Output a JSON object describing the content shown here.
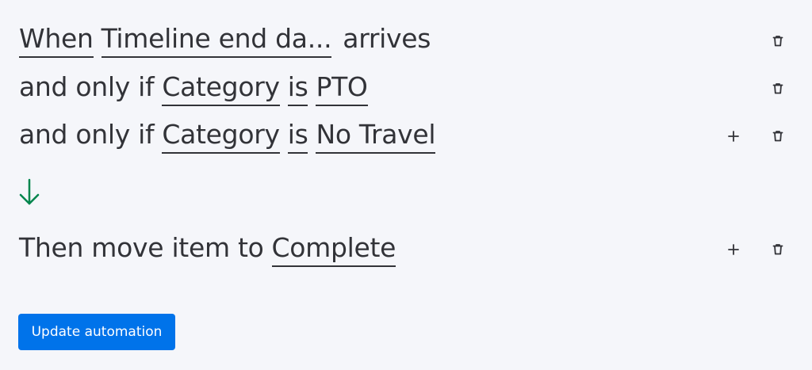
{
  "colors": {
    "background": "#f5f6fa",
    "text": "#323338",
    "accent": "#0073ea",
    "arrow": "#00854d",
    "button_text": "#ffffff"
  },
  "rules": {
    "trigger": {
      "prefix": "When",
      "field": "Timeline end da...",
      "suffix": "arrives"
    },
    "condition_1": {
      "prefix": "and only if",
      "field": "Category",
      "operator": "is",
      "value": "PTO"
    },
    "condition_2": {
      "prefix": "and only if",
      "field": "Category",
      "operator": "is",
      "value": "No Travel"
    },
    "action": {
      "prefix": "Then move item to",
      "value": "Complete"
    }
  },
  "icons": {
    "trash": "trash-icon",
    "plus": "plus-icon",
    "arrow": "arrow-down-icon"
  },
  "footer": {
    "button_label": "Update automation"
  }
}
